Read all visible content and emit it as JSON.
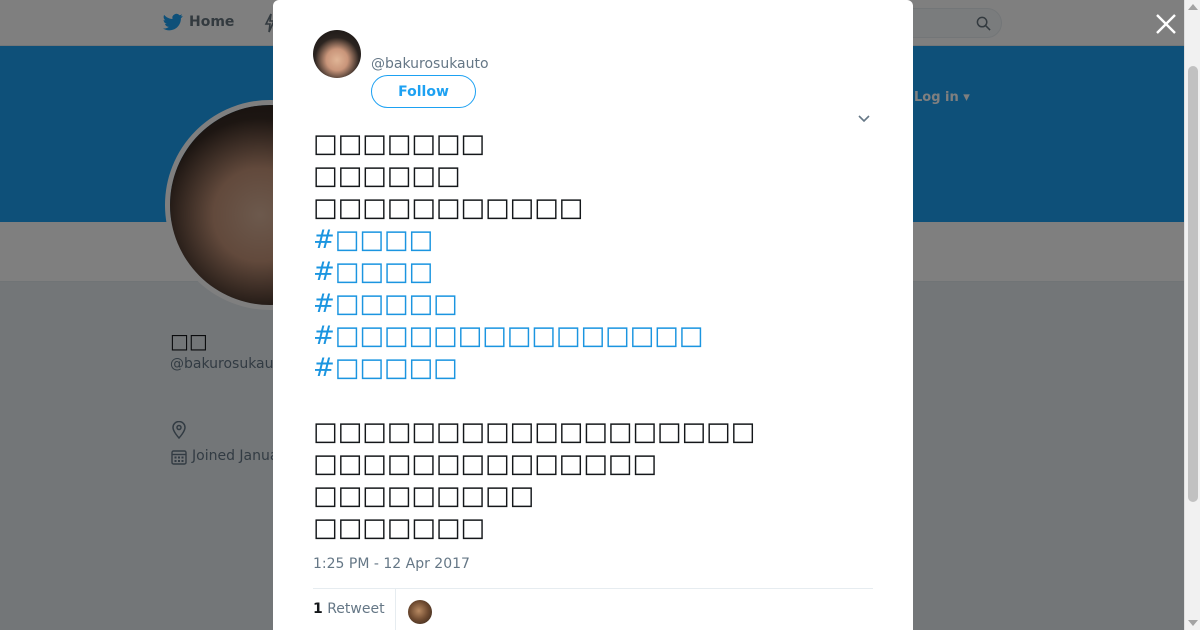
{
  "topbar": {
    "home_label": "Home",
    "login_label": "Log in ▾"
  },
  "profile": {
    "name": "□□",
    "handle": "@bakurosukaut",
    "joined": "Joined Janua"
  },
  "tweet": {
    "handle": "@bakurosukauto",
    "follow_label": "Follow",
    "lines": [
      {
        "text": "□□□□□□□",
        "hashtag": false
      },
      {
        "text": "□□□□□□",
        "hashtag": false
      },
      {
        "text": "□□□□□□□□□□□",
        "hashtag": false
      },
      {
        "text": "#□□□□",
        "hashtag": true
      },
      {
        "text": "#□□□□",
        "hashtag": true
      },
      {
        "text": "#□□□□□",
        "hashtag": true
      },
      {
        "text": "#□□□□□□□□□□□□□□□",
        "hashtag": true
      },
      {
        "text": "#□□□□□",
        "hashtag": true
      },
      {
        "text": "",
        "hashtag": false
      },
      {
        "text": "□□□□□□□□□□□□□□□□□□",
        "hashtag": false
      },
      {
        "text": "□□□□□□□□□□□□□□",
        "hashtag": false
      },
      {
        "text": "□□□□□□□□□",
        "hashtag": false
      },
      {
        "text": "□□□□□□□",
        "hashtag": false
      }
    ],
    "timestamp": "1:25 PM - 12 Apr 2017",
    "retweet_count": "1",
    "retweet_label": "Retweet"
  },
  "colors": {
    "accent": "#1da1f2",
    "hashtag": "#1b95e0",
    "text": "#14171a",
    "muted": "#657786"
  },
  "icons": [
    "twitter-bird-icon",
    "moments-bolt-icon",
    "search-icon",
    "location-pin-icon",
    "calendar-icon",
    "close-icon",
    "caret-down-icon"
  ]
}
